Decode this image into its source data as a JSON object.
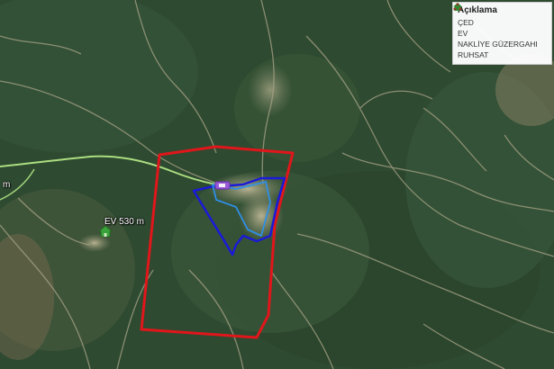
{
  "legend": {
    "title": "Açıklama",
    "items": [
      {
        "label": "ÇED",
        "icon": "ced-symbol-icon",
        "color": "#3a3fd1"
      },
      {
        "label": "EV",
        "icon": "house-icon",
        "color": "#2f8a2f"
      },
      {
        "label": "NAKLİYE GÜZERGAHI",
        "icon": "route-symbol-icon",
        "color": "#6fbf5a"
      },
      {
        "label": "RUHSAT",
        "icon": "ruhsat-symbol-icon",
        "color": "#8a3a2a"
      }
    ]
  },
  "labels": {
    "ev_distance": "EV 530 m",
    "left_edge": "m"
  },
  "colors": {
    "ruhsat_boundary": "#e0161b",
    "ced_boundary": "#1a1ad8",
    "ced_inner": "#2f8fe6",
    "transport_route": "#b9ee8a",
    "house_marker": "#3aa23a"
  }
}
